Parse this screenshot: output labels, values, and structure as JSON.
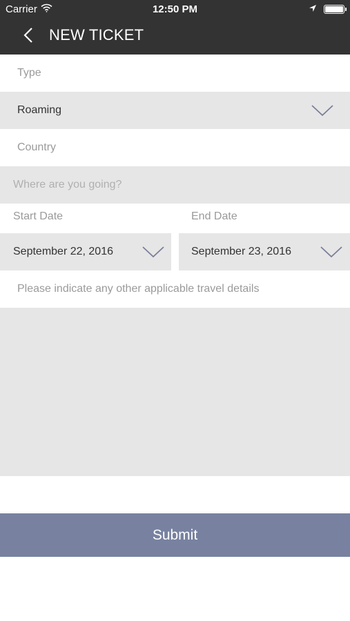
{
  "status_bar": {
    "carrier": "Carrier",
    "time": "12:50 PM",
    "wifi_icon": "wifi-icon",
    "location_icon": "location-arrow-icon",
    "battery_icon": "battery-icon"
  },
  "nav": {
    "title": "NEW TICKET",
    "back_icon": "chevron-left-icon"
  },
  "form": {
    "type_label": "Type",
    "type_value": "Roaming",
    "country_label": "Country",
    "country_placeholder": "Where are you going?",
    "start_date_label": "Start Date",
    "start_date_value": "September 22, 2016",
    "end_date_label": "End Date",
    "end_date_value": "September 23, 2016",
    "details_label": "Please indicate any other applicable travel details",
    "details_value": ""
  },
  "actions": {
    "submit_label": "Submit"
  },
  "colors": {
    "header_bg": "#333333",
    "field_bg": "#e6e6e6",
    "submit_bg": "#7882a0",
    "chevron": "#7a7f9a"
  }
}
